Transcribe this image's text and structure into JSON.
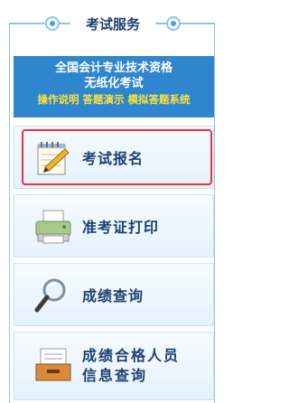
{
  "header": {
    "title": "考试服务"
  },
  "banner": {
    "line1": "全国会计专业技术资格",
    "line2": "无纸化考试",
    "links": "操作说明 答题演示 模拟答题系统"
  },
  "menu": {
    "items": [
      {
        "label": "考试报名",
        "icon": "notepad-pencil-icon",
        "selected": true
      },
      {
        "label": "准考证打印",
        "icon": "printer-icon"
      },
      {
        "label": "成绩查询",
        "icon": "magnifier-icon"
      },
      {
        "label_line1": "成绩合格人员",
        "label_line2": "信息查询",
        "icon": "file-tray-icon"
      }
    ]
  },
  "colors": {
    "border": "#8fc3e6",
    "banner_bg": "#2f86cf",
    "banner_link": "#ffe23a",
    "label": "#1f3f70",
    "highlight": "#e8333a"
  }
}
